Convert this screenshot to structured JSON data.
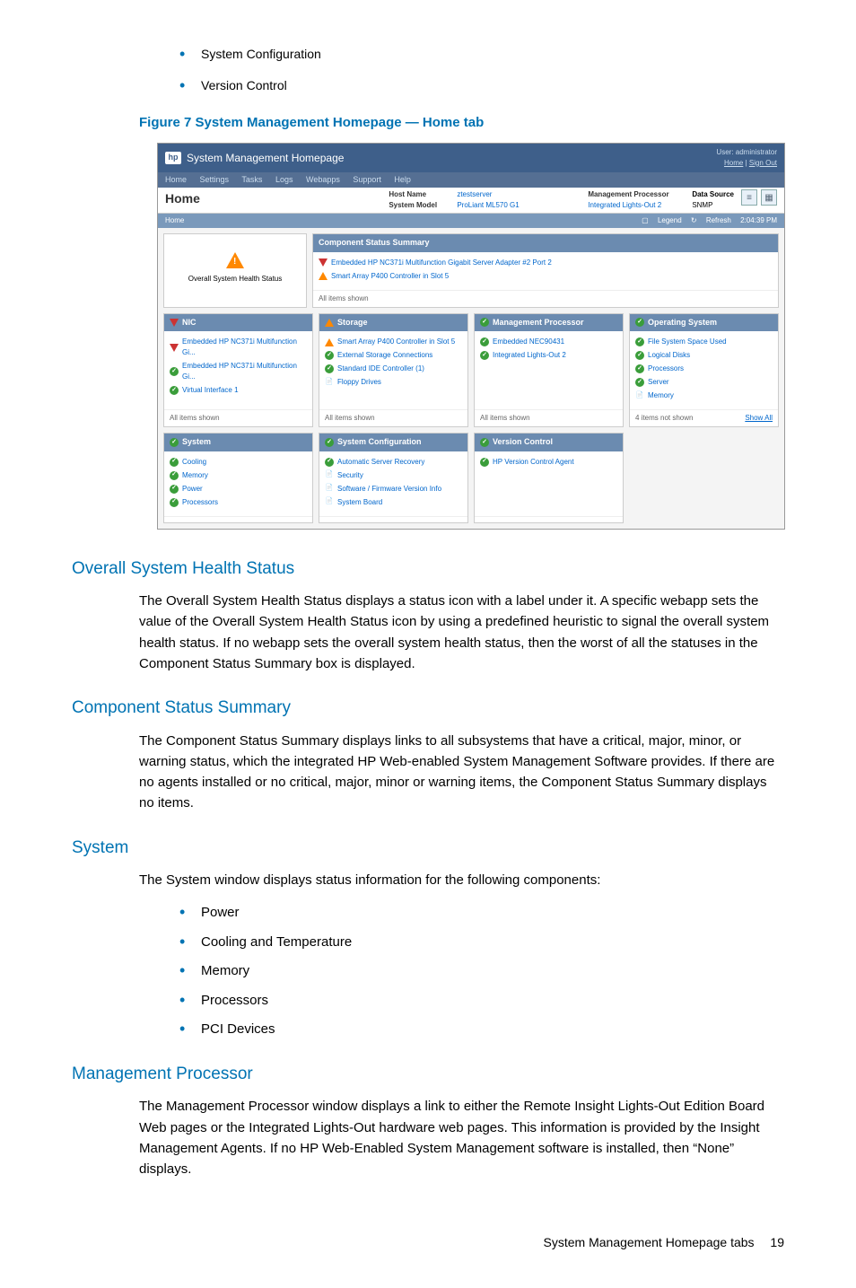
{
  "intro_list": [
    "System Configuration",
    "Version Control"
  ],
  "figure_caption": "Figure 7 System Management Homepage — Home tab",
  "screenshot": {
    "app_title": "System Management Homepage",
    "user_label": "User: administrator",
    "user_links": [
      "Home",
      "Sign Out"
    ],
    "menu": [
      "Home",
      "Settings",
      "Tasks",
      "Logs",
      "Webapps",
      "Support",
      "Help"
    ],
    "page_title": "Home",
    "info": {
      "host_name_label": "Host Name",
      "host_name": "ztestserver",
      "system_model_label": "System Model",
      "system_model": "ProLiant ML570 G1",
      "mgmt_proc_label": "Management Processor",
      "mgmt_proc": "Integrated Lights-Out 2",
      "data_source_label": "Data Source",
      "data_source": "SNMP"
    },
    "bar": {
      "left": "Home",
      "legend": "Legend",
      "refresh": "Refresh",
      "time": "2:04:39 PM"
    },
    "health_label": "Overall System Health Status",
    "summary_title": "Component Status Summary",
    "summary_items": [
      {
        "icon": "crit",
        "text": "Embedded HP NC371i Multifunction Gigabit Server Adapter #2 Port 2"
      },
      {
        "icon": "warn",
        "text": "Smart Array P400 Controller in Slot 5"
      }
    ],
    "summary_foot": "All items shown",
    "panels": [
      {
        "title": "NIC",
        "head_icon": "crit",
        "items": [
          {
            "icon": "crit",
            "text": "Embedded HP NC371i Multifunction Gi..."
          },
          {
            "icon": "ok",
            "text": "Embedded HP NC371i Multifunction Gi..."
          },
          {
            "icon": "ok",
            "text": "Virtual Interface 1"
          }
        ],
        "foot": "All items shown"
      },
      {
        "title": "Storage",
        "head_icon": "warn",
        "items": [
          {
            "icon": "warn",
            "text": "Smart Array P400 Controller in Slot 5"
          },
          {
            "icon": "ok",
            "text": "External Storage Connections"
          },
          {
            "icon": "ok",
            "text": "Standard IDE Controller (1)"
          },
          {
            "icon": "doc",
            "text": "Floppy Drives"
          }
        ],
        "foot": "All items shown"
      },
      {
        "title": "Management Processor",
        "head_icon": "ok",
        "items": [
          {
            "icon": "ok",
            "text": "Embedded NEC90431"
          },
          {
            "icon": "ok",
            "text": "Integrated Lights-Out 2"
          }
        ],
        "foot": "All items shown"
      },
      {
        "title": "Operating System",
        "head_icon": "ok",
        "items": [
          {
            "icon": "ok",
            "text": "File System Space Used"
          },
          {
            "icon": "ok",
            "text": "Logical Disks"
          },
          {
            "icon": "ok",
            "text": "Processors"
          },
          {
            "icon": "ok",
            "text": "Server"
          },
          {
            "icon": "doc",
            "text": "Memory"
          }
        ],
        "foot": "4 items not shown",
        "foot_link": "Show All"
      },
      {
        "title": "System",
        "head_icon": "ok",
        "items": [
          {
            "icon": "ok",
            "text": "Cooling"
          },
          {
            "icon": "ok",
            "text": "Memory"
          },
          {
            "icon": "ok",
            "text": "Power"
          },
          {
            "icon": "ok",
            "text": "Processors"
          }
        ],
        "foot": ""
      },
      {
        "title": "System Configuration",
        "head_icon": "ok",
        "items": [
          {
            "icon": "ok",
            "text": "Automatic Server Recovery"
          },
          {
            "icon": "doc",
            "text": "Security"
          },
          {
            "icon": "doc",
            "text": "Software / Firmware Version Info"
          },
          {
            "icon": "doc",
            "text": "System Board"
          }
        ],
        "foot": ""
      },
      {
        "title": "Version Control",
        "head_icon": "ok",
        "items": [
          {
            "icon": "ok",
            "text": "HP Version Control Agent"
          }
        ],
        "foot": ""
      }
    ]
  },
  "sections": {
    "overall": {
      "title": "Overall System Health Status",
      "p": "The Overall System Health Status displays a status icon with a label under it. A specific webapp sets the value of the Overall System Health Status icon by using a predefined heuristic to signal the overall system health status. If no webapp sets the overall system health status, then the worst of all the statuses in the Component Status Summary box is displayed."
    },
    "css": {
      "title": "Component Status Summary",
      "p": "The Component Status Summary displays links to all subsystems that have a critical, major, minor, or warning status, which the integrated HP Web-enabled System Management Software provides. If there are no agents installed or no critical, major, minor or warning items, the Component Status Summary displays no items."
    },
    "system": {
      "title": "System",
      "p": "The System window displays status information for the following components:",
      "list": [
        "Power",
        "Cooling and Temperature",
        "Memory",
        "Processors",
        "PCI Devices"
      ]
    },
    "mgmt": {
      "title": "Management Processor",
      "p": "The Management Processor window displays a link to either the Remote Insight Lights-Out Edition Board Web pages or the Integrated Lights-Out hardware web pages. This information is provided by the Insight Management Agents. If no HP Web-Enabled System Management software is installed, then “None” displays."
    }
  },
  "footer": {
    "text": "System Management Homepage tabs",
    "page": "19"
  }
}
